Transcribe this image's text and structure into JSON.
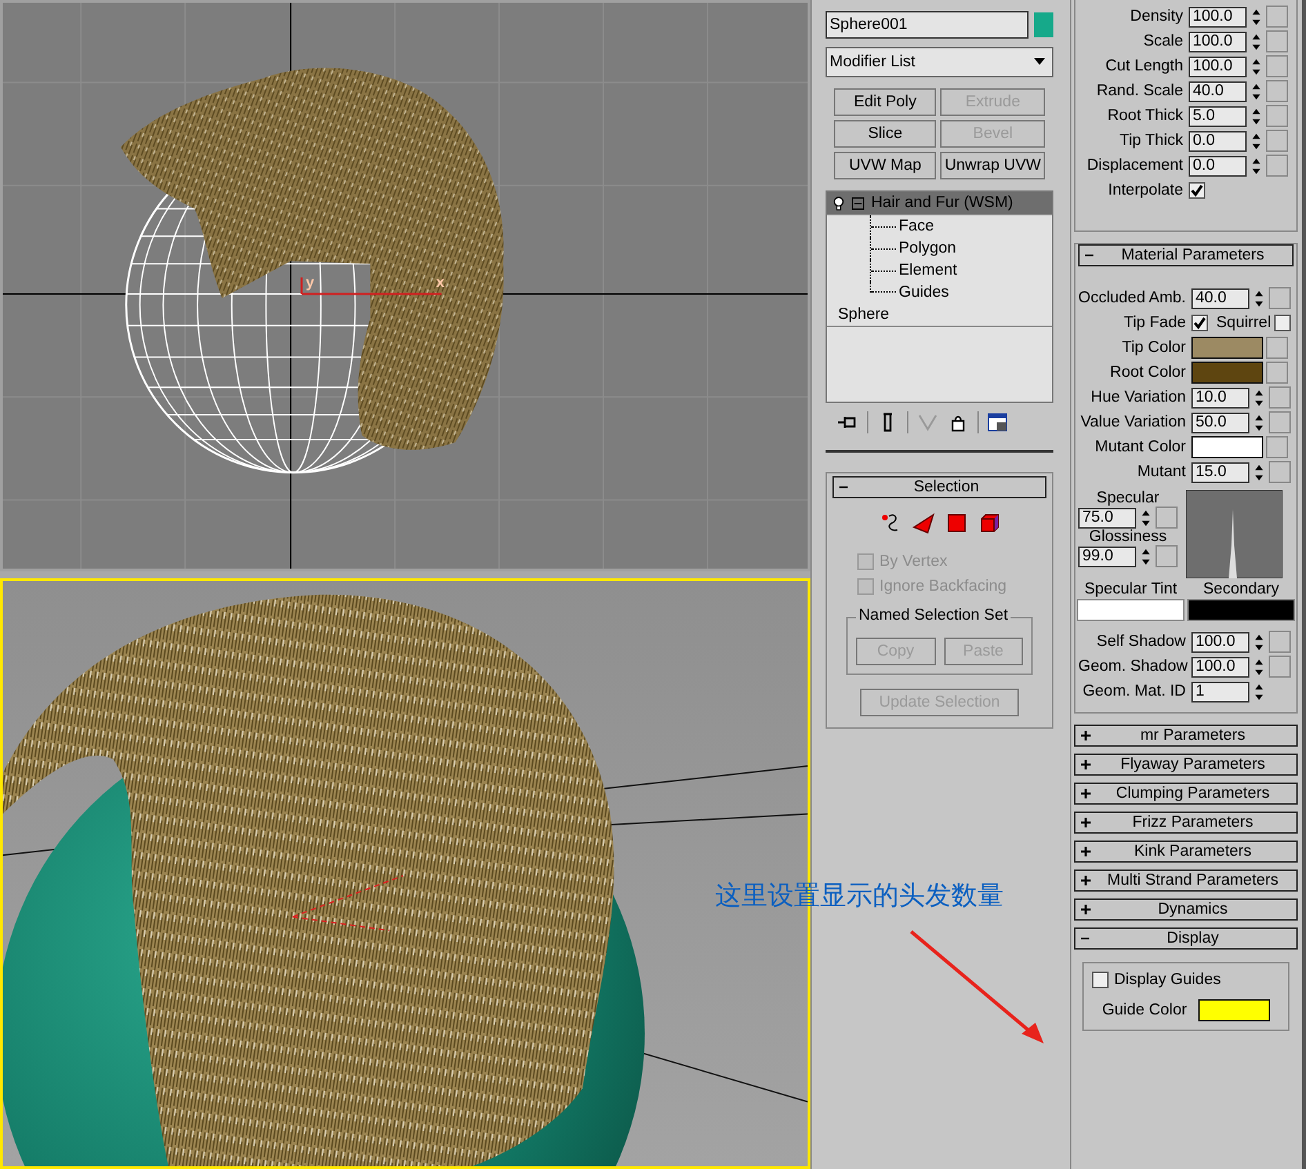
{
  "viewports": [
    {
      "kind": "wireframe",
      "active": false,
      "axis_labels": [
        "y",
        "x"
      ]
    },
    {
      "kind": "shaded",
      "active": true
    }
  ],
  "modify_panel": {
    "object": {
      "name": "Sphere001",
      "color": "#16a98a"
    },
    "modifier_list": "Modifier List",
    "buttons": [
      {
        "label": "Edit Poly",
        "disabled": false
      },
      {
        "label": "Extrude",
        "disabled": true
      },
      {
        "label": "Slice",
        "disabled": false
      },
      {
        "label": "Bevel",
        "disabled": true
      },
      {
        "label": "UVW Map",
        "disabled": false
      },
      {
        "label": "Unwrap UVW",
        "disabled": false
      }
    ],
    "stack": [
      {
        "label": "Hair and Fur (WSM)",
        "selected": true,
        "expanded": true,
        "children": [
          {
            "label": "Face"
          },
          {
            "label": "Polygon"
          },
          {
            "label": "Element"
          },
          {
            "label": "Guides"
          }
        ]
      },
      {
        "label": "Sphere",
        "selected": false
      }
    ],
    "selection": {
      "title": "Selection",
      "expanded": true,
      "checkboxes": [
        {
          "label": "By Vertex",
          "checked": false,
          "disabled": true
        },
        {
          "label": "Ignore Backfacing",
          "checked": false,
          "disabled": true
        }
      ],
      "group_title": "Named Selection Set",
      "group_buttons": [
        {
          "label": "Copy",
          "disabled": true
        },
        {
          "label": "Paste",
          "disabled": true
        }
      ],
      "update_button": {
        "label": "Update Selection",
        "disabled": true
      }
    }
  },
  "parameters": {
    "general": [
      {
        "label": "Density",
        "value": "100.0"
      },
      {
        "label": "Scale",
        "value": "100.0"
      },
      {
        "label": "Cut Length",
        "value": "100.0"
      },
      {
        "label": "Rand. Scale",
        "value": "40.0"
      },
      {
        "label": "Root Thick",
        "value": "5.0"
      },
      {
        "label": "Tip Thick",
        "value": "0.0"
      },
      {
        "label": "Displacement",
        "value": "0.0"
      }
    ],
    "interpolate": {
      "label": "Interpolate",
      "checked": true
    },
    "material": {
      "title": "Material Parameters",
      "expanded": true,
      "rows": [
        {
          "kind": "spinner",
          "label": "Occluded Amb.",
          "value": "40.0"
        },
        {
          "kind": "checks",
          "items": [
            {
              "label": "Tip Fade",
              "checked": true
            },
            {
              "label": "Squirrel",
              "checked": false
            }
          ]
        },
        {
          "kind": "color",
          "label": "Tip Color",
          "color": "#9c8a63"
        },
        {
          "kind": "color",
          "label": "Root Color",
          "color": "#5e4510"
        },
        {
          "kind": "spinner",
          "label": "Hue Variation",
          "value": "10.0"
        },
        {
          "kind": "spinner",
          "label": "Value Variation",
          "value": "50.0"
        },
        {
          "kind": "color",
          "label": "Mutant Color",
          "color": "#ffffff"
        },
        {
          "kind": "spinner",
          "label": "Mutant",
          "value": "15.0"
        }
      ],
      "specular": {
        "specular_label": "Specular",
        "specular": "75.0",
        "glossiness_label": "Glossiness",
        "glossiness": "99.0",
        "swatches": [
          {
            "label": "Specular Tint",
            "color": "#ffffff"
          },
          {
            "label": "Secondary",
            "color": "#000000"
          }
        ]
      },
      "rows_after": [
        {
          "label": "Self Shadow",
          "value": "100.0",
          "map": true
        },
        {
          "label": "Geom. Shadow",
          "value": "100.0",
          "map": true
        },
        {
          "label": "Geom. Mat. ID",
          "value": "1",
          "map": false
        }
      ]
    },
    "rollouts": [
      {
        "title": "mr Parameters",
        "expanded": false
      },
      {
        "title": "Flyaway Parameters",
        "expanded": false
      },
      {
        "title": "Clumping Parameters",
        "expanded": false
      },
      {
        "title": "Frizz Parameters",
        "expanded": false
      },
      {
        "title": "Kink Parameters",
        "expanded": false
      },
      {
        "title": "Multi Strand Parameters",
        "expanded": false
      },
      {
        "title": "Dynamics",
        "expanded": false
      },
      {
        "title": "Display",
        "expanded": true
      }
    ],
    "display": {
      "checkbox": {
        "label": "Display Guides",
        "checked": false
      },
      "guide": {
        "label": "Guide Color",
        "color": "#ffff00"
      }
    }
  },
  "annotation": {
    "text": "这里设置显示的头发数量"
  }
}
